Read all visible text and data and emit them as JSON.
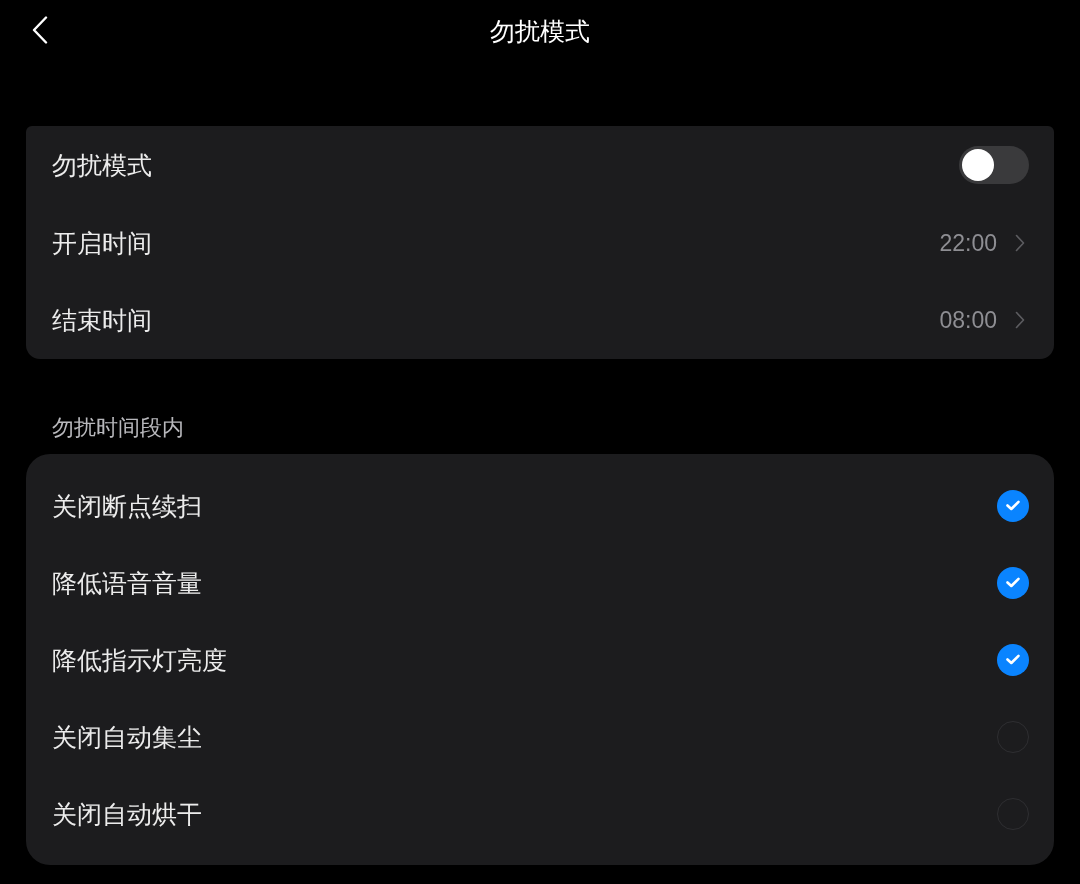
{
  "header": {
    "title": "勿扰模式"
  },
  "schedule": [
    {
      "kind": "toggle",
      "label": "勿扰模式",
      "on": false
    },
    {
      "kind": "time",
      "label": "开启时间",
      "value": "22:00"
    },
    {
      "kind": "time",
      "label": "结束时间",
      "value": "08:00"
    }
  ],
  "section": {
    "label": "勿扰时间段内",
    "options": [
      {
        "label": "关闭断点续扫",
        "checked": true
      },
      {
        "label": "降低语音音量",
        "checked": true
      },
      {
        "label": "降低指示灯亮度",
        "checked": true
      },
      {
        "label": "关闭自动集尘",
        "checked": false
      },
      {
        "label": "关闭自动烘干",
        "checked": false
      }
    ]
  }
}
